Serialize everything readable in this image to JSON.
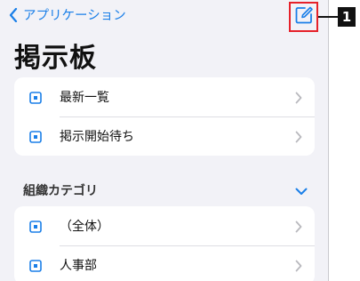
{
  "nav": {
    "back_label": "アプリケーション"
  },
  "page": {
    "title": "掲示板"
  },
  "top_list": [
    {
      "label": "最新一覧"
    },
    {
      "label": "掲示開始待ち"
    }
  ],
  "category_section": {
    "label": "組織カテゴリ"
  },
  "category_list": [
    {
      "label": "（全体）"
    },
    {
      "label": "人事部"
    }
  ],
  "callout": {
    "number": "1"
  },
  "colors": {
    "accent": "#1a7fe8",
    "highlight_border": "#e6212a",
    "background": "#f2f2f7"
  }
}
